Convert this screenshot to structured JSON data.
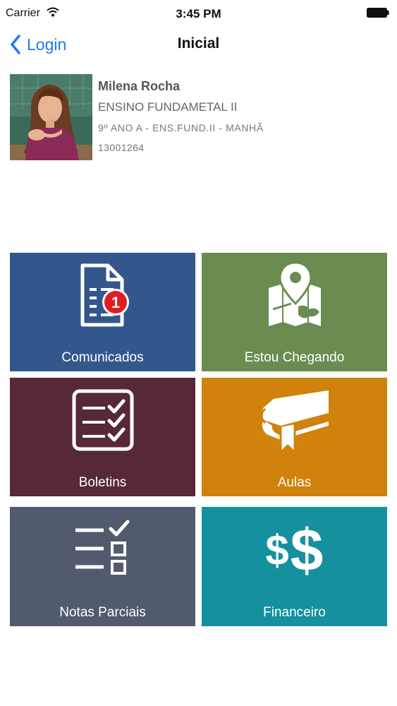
{
  "status_bar": {
    "carrier": "Carrier",
    "time": "3:45 PM"
  },
  "nav": {
    "back_label": "Login",
    "title": "Inicial"
  },
  "profile": {
    "name": "Milena Rocha",
    "level": "ENSINO FUNDAMETAL II",
    "class": "9º ANO A - ENS.FUND.II - MANHÃ",
    "id": "13001264"
  },
  "tiles": [
    {
      "label": "Comunicados",
      "icon": "document-icon",
      "color": "#33578d",
      "badge": "1"
    },
    {
      "label": "Estou Chegando",
      "icon": "map-pin-icon",
      "color": "#6a8c51"
    },
    {
      "label": "Boletins",
      "icon": "checklist-icon",
      "color": "#562838"
    },
    {
      "label": "Aulas",
      "icon": "book-icon",
      "color": "#d0820c"
    },
    {
      "label": "Notas Parciais",
      "icon": "partial-grades-icon",
      "color": "#525a6e"
    },
    {
      "label": "Financeiro",
      "icon": "dollar-icon",
      "color": "#14909f"
    }
  ],
  "colors": {
    "accent": "#1a7cf0",
    "badge": "#e01e22"
  }
}
